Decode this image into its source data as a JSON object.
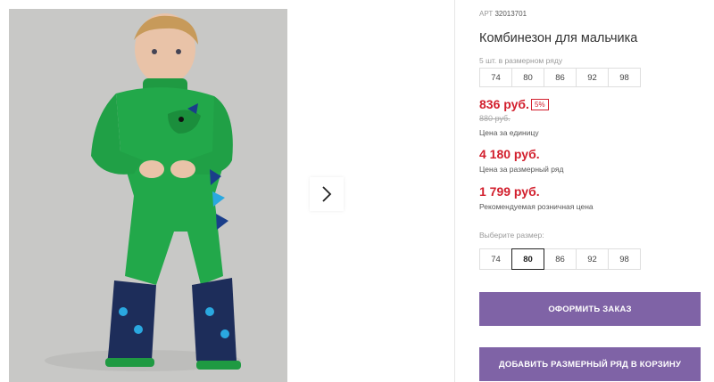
{
  "product": {
    "article_label": "АРТ",
    "article": "32013701",
    "title": "Комбинезон для мальчика",
    "pack_label": "5 шт. в размерном ряду",
    "pack_sizes": [
      "74",
      "80",
      "86",
      "92",
      "98"
    ],
    "price": "836 руб.",
    "discount": "5%",
    "old_price": "880 руб.",
    "price_caption": "Цена за единицу",
    "row_price": "4 180 руб.",
    "row_price_caption": "Цена за размерный ряд",
    "retail_price": "1 799 руб.",
    "retail_caption": "Рекомендуемая розничная цена",
    "select_label": "Выберите размер:",
    "select_sizes": [
      "74",
      "80",
      "86",
      "92",
      "98"
    ],
    "selected_size": "80"
  },
  "buttons": {
    "order": "ОФОРМИТЬ ЗАКАЗ",
    "add_row": "ДОБАВИТЬ РАЗМЕРНЫЙ РЯД В КОРЗИНУ"
  },
  "colors": {
    "accent": "#7f63a6",
    "price": "#d21f2d",
    "product_green": "#22a84a"
  },
  "icons": {
    "next": "chevron-right-icon"
  }
}
